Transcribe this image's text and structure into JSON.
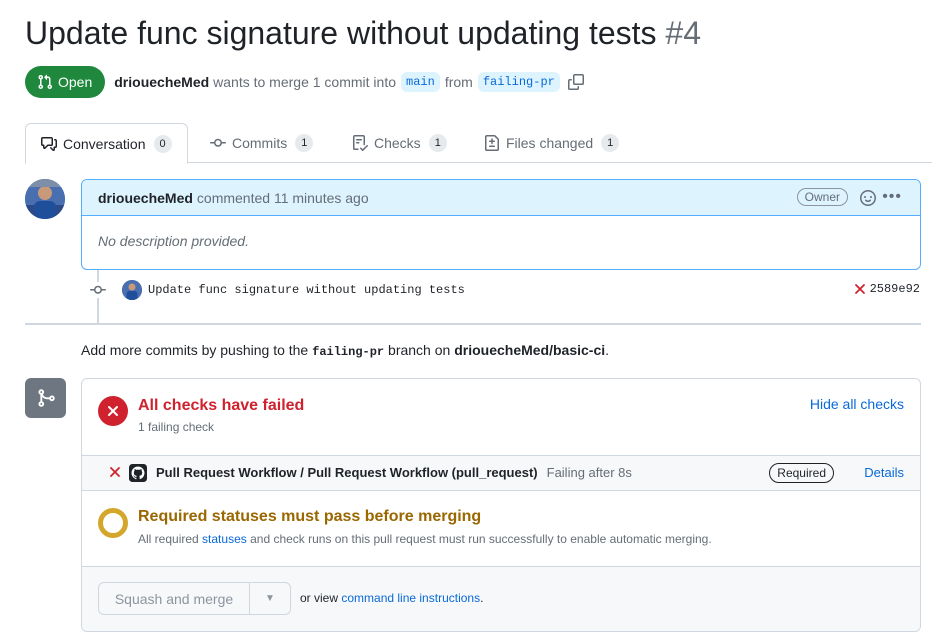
{
  "pr": {
    "title": "Update func signature without updating tests",
    "number": "#4",
    "state": "Open",
    "author": "driouecheMed",
    "merge_text": "wants to merge 1 commit into",
    "base_branch": "main",
    "from_text": "from",
    "head_branch": "failing-pr"
  },
  "tabs": [
    {
      "label": "Conversation",
      "count": "0"
    },
    {
      "label": "Commits",
      "count": "1"
    },
    {
      "label": "Checks",
      "count": "1"
    },
    {
      "label": "Files changed",
      "count": "1"
    }
  ],
  "comment": {
    "author": "driouecheMed",
    "action": "commented 11 minutes ago",
    "role_badge": "Owner",
    "body": "No description provided."
  },
  "commit": {
    "message": "Update func signature without updating tests",
    "sha": "2589e92"
  },
  "hint": {
    "prefix": "Add more commits by pushing to the",
    "branch": "failing-pr",
    "middle": "branch on",
    "repo": "driouecheMed/basic-ci",
    "suffix": "."
  },
  "checks": {
    "title": "All checks have failed",
    "subtitle": "1 failing check",
    "hide_link": "Hide all checks",
    "items": [
      {
        "name": "Pull Request Workflow / Pull Request Workflow (pull_request)",
        "status": "Failing after 8s",
        "badge": "Required",
        "details": "Details"
      }
    ]
  },
  "required": {
    "title": "Required statuses must pass before merging",
    "prefix": "All required",
    "link": "statuses",
    "suffix": "and check runs on this pull request must run successfully to enable automatic merging."
  },
  "merge": {
    "button": "Squash and merge",
    "or_view": "or view",
    "cli_link": "command line instructions",
    "period": "."
  },
  "colors": {
    "open_green": "#1f883d",
    "fail_red": "#cf222e",
    "pending_yellow": "#d4a72c",
    "link_blue": "#0969da"
  }
}
